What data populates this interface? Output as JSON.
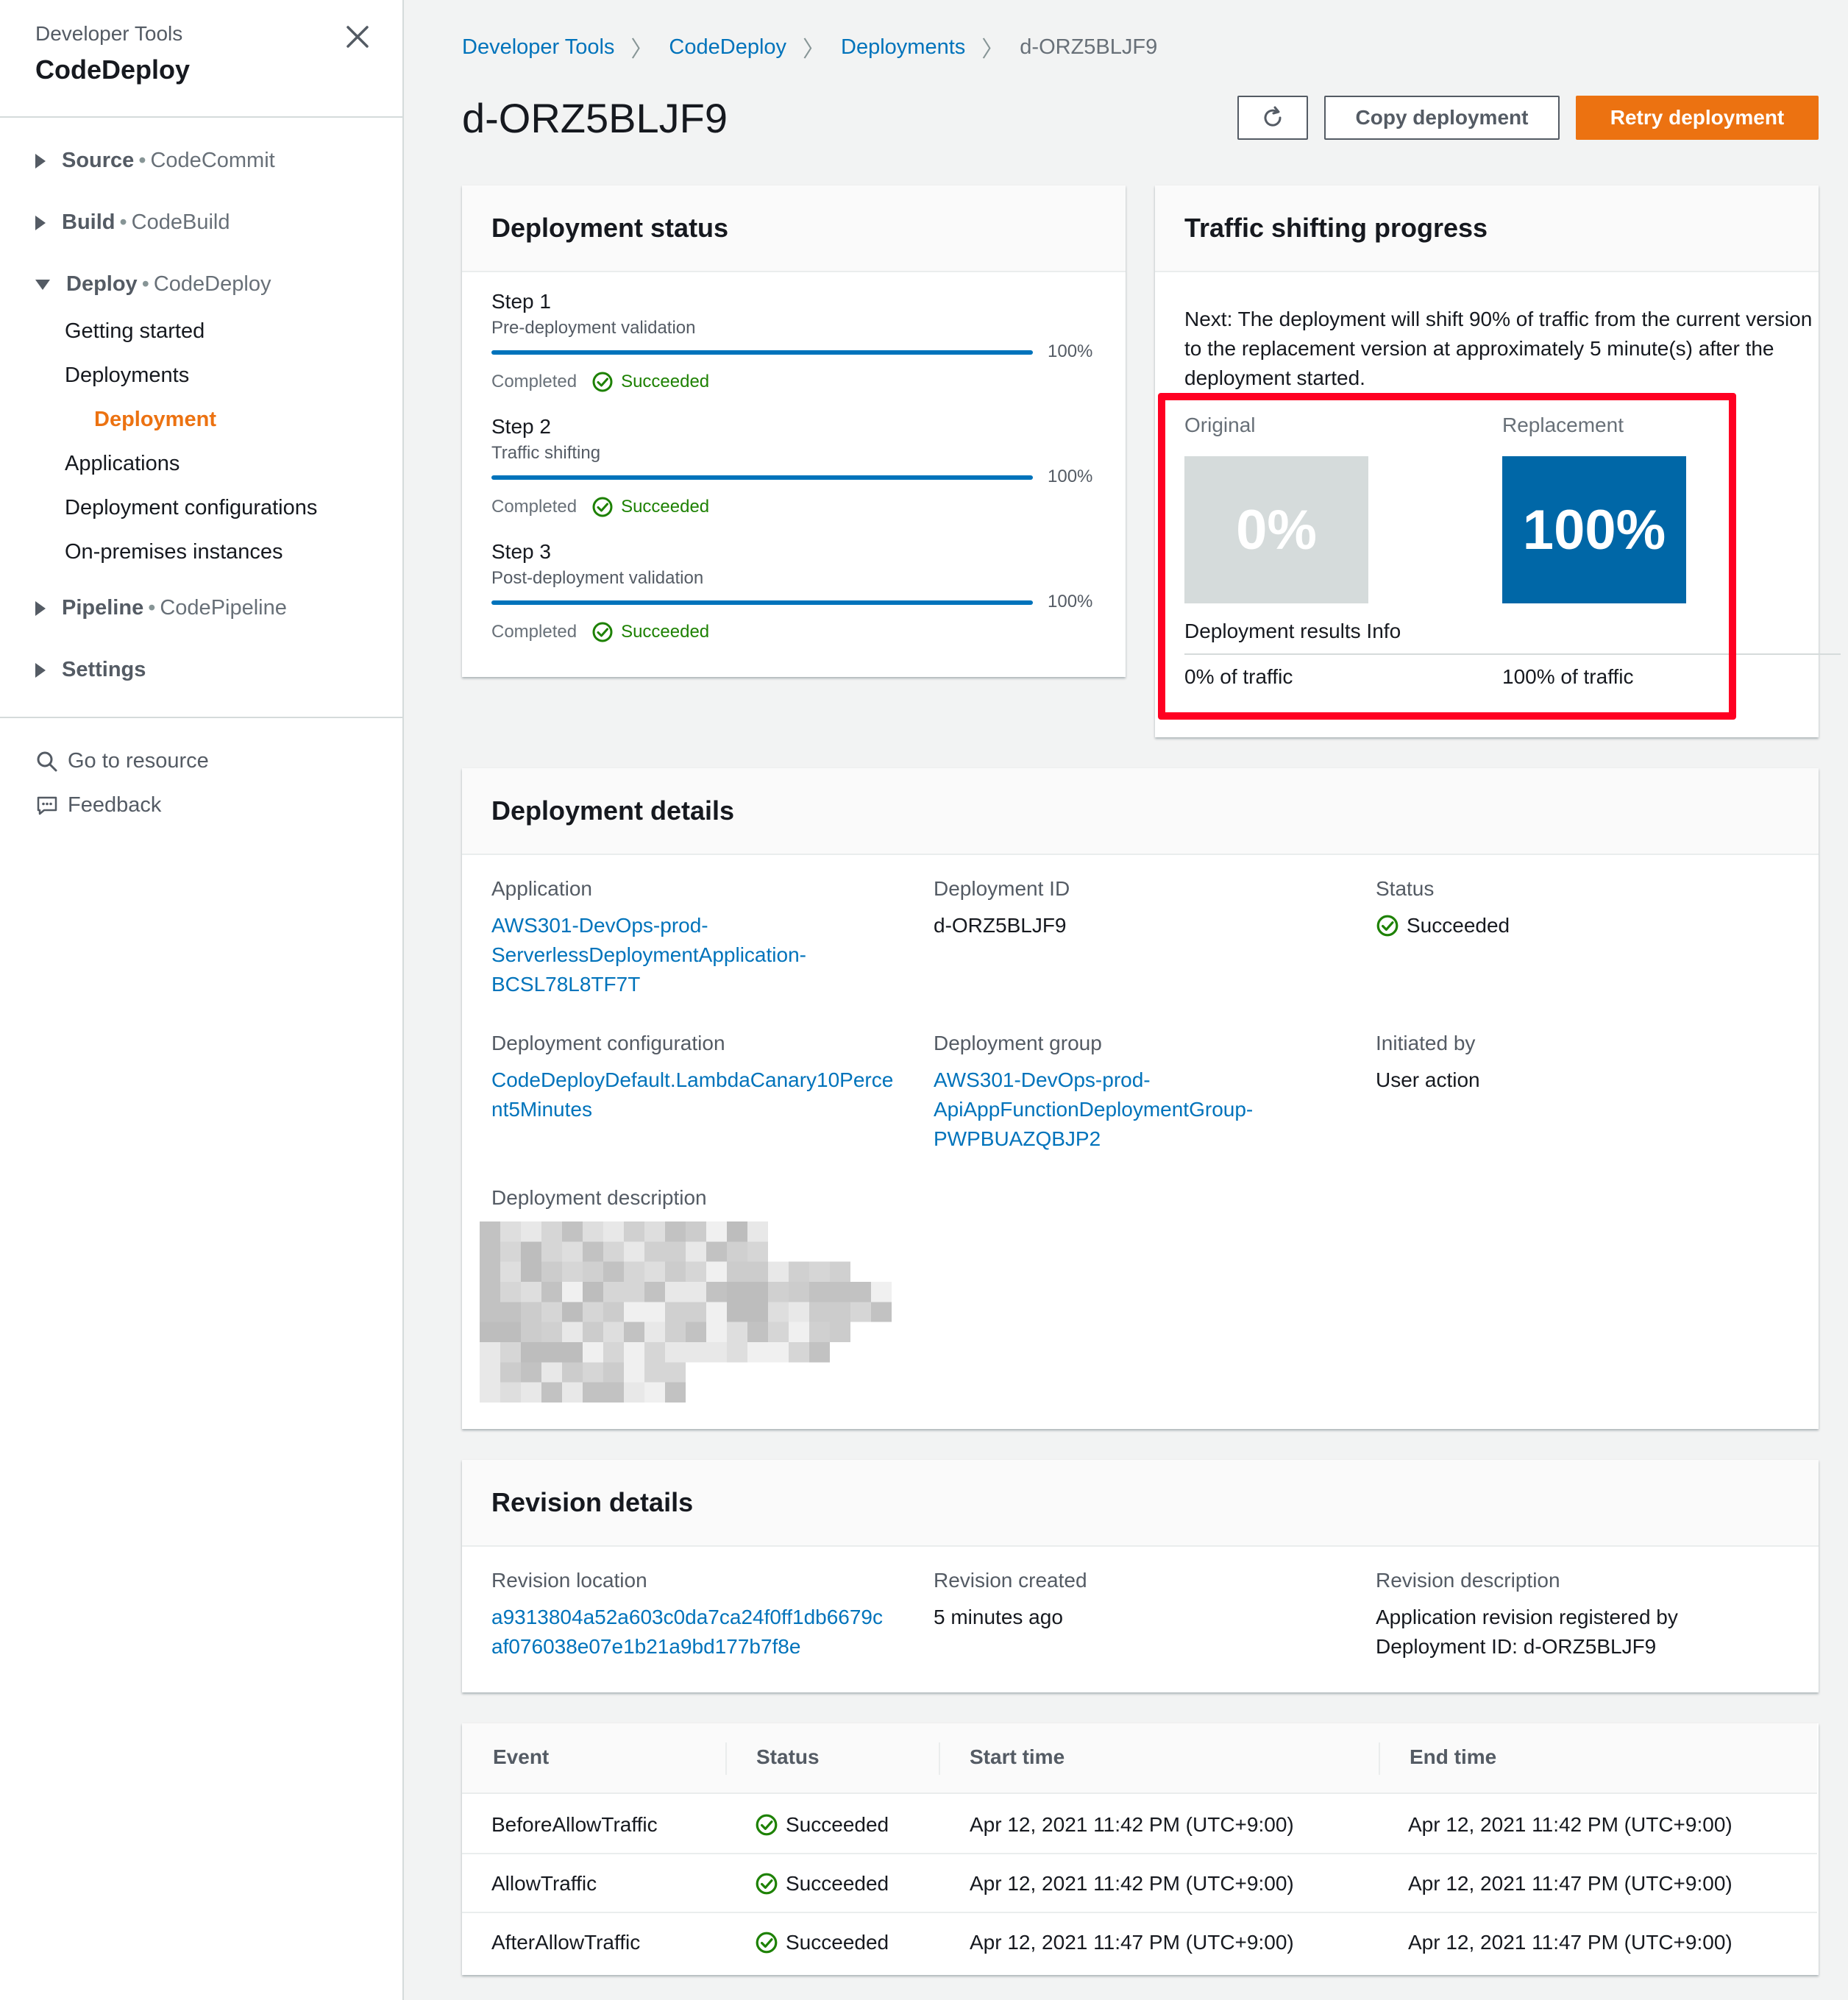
{
  "sidebar": {
    "subtitle": "Developer Tools",
    "title": "CodeDeploy",
    "groups": [
      {
        "label": "Source",
        "service": "CodeCommit"
      },
      {
        "label": "Build",
        "service": "CodeBuild"
      },
      {
        "label": "Deploy",
        "service": "CodeDeploy"
      },
      {
        "label": "Pipeline",
        "service": "CodePipeline"
      },
      {
        "label": "Settings"
      }
    ],
    "deploy_items": [
      "Getting started",
      "Deployments",
      "Deployment",
      "Applications",
      "Deployment configurations",
      "On-premises instances"
    ],
    "tools": [
      "Go to resource",
      "Feedback"
    ]
  },
  "breadcrumb": [
    "Developer Tools",
    "CodeDeploy",
    "Deployments",
    "d-ORZ5BLJF9"
  ],
  "page": {
    "title": "d-ORZ5BLJF9",
    "copy_button": "Copy deployment",
    "retry_button": "Retry deployment"
  },
  "deployment_status": {
    "title": "Deployment status",
    "steps": [
      {
        "title": "Step 1",
        "subtitle": "Pre-deployment validation",
        "percent": "100%",
        "completed": "Completed",
        "status": "Succeeded"
      },
      {
        "title": "Step 2",
        "subtitle": "Traffic shifting",
        "percent": "100%",
        "completed": "Completed",
        "status": "Succeeded"
      },
      {
        "title": "Step 3",
        "subtitle": "Post-deployment validation",
        "percent": "100%",
        "completed": "Completed",
        "status": "Succeeded"
      }
    ]
  },
  "traffic": {
    "title": "Traffic shifting progress",
    "next_text": "Next: The deployment will shift 90% of traffic from the current version to the replacement version at approximately 5 minute(s) after the deployment started.",
    "original_label": "Original",
    "replacement_label": "Replacement",
    "original_pct": "0%",
    "replacement_pct": "100%",
    "results_label": "Deployment results Info",
    "original_traffic": "0% of traffic",
    "replacement_traffic": "100% of traffic",
    "original_color": "#d5dbdb",
    "replacement_color": "#0067a7"
  },
  "details": {
    "title": "Deployment details",
    "application_label": "Application",
    "application": [
      "AWS301-DevOps-prod-",
      "ServerlessDeploymentApplication-",
      "BCSL78L8TF7T"
    ],
    "deployment_id_label": "Deployment ID",
    "deployment_id": "d-ORZ5BLJF9",
    "status_label": "Status",
    "status": "Succeeded",
    "config_label": "Deployment configuration",
    "config": [
      "CodeDeployDefault.LambdaCanary10Perce",
      "nt5Minutes"
    ],
    "group_label": "Deployment group",
    "group": [
      "AWS301-DevOps-prod-",
      "ApiAppFunctionDeploymentGroup-",
      "PWPBUAZQBJP2"
    ],
    "initiated_label": "Initiated by",
    "initiated": "User action",
    "description_label": "Deployment description"
  },
  "revision": {
    "title": "Revision details",
    "location_label": "Revision location",
    "location": [
      "a9313804a52a603c0da7ca24f0ff1db6679c",
      "af076038e07e1b21a9bd177b7f8e"
    ],
    "created_label": "Revision created",
    "created": "5 minutes ago",
    "description_label": "Revision description",
    "description": [
      "Application revision registered by",
      "Deployment ID: d-ORZ5BLJF9"
    ]
  },
  "events": {
    "columns": [
      "Event",
      "Status",
      "Start time",
      "End time"
    ],
    "rows": [
      {
        "event": "BeforeAllowTraffic",
        "status": "Succeeded",
        "start": "Apr 12, 2021 11:42 PM (UTC+9:00)",
        "end": "Apr 12, 2021 11:42 PM (UTC+9:00)"
      },
      {
        "event": "AllowTraffic",
        "status": "Succeeded",
        "start": "Apr 12, 2021 11:42 PM (UTC+9:00)",
        "end": "Apr 12, 2021 11:47 PM (UTC+9:00)"
      },
      {
        "event": "AfterAllowTraffic",
        "status": "Succeeded",
        "start": "Apr 12, 2021 11:47 PM (UTC+9:00)",
        "end": "Apr 12, 2021 11:47 PM (UTC+9:00)"
      }
    ]
  }
}
